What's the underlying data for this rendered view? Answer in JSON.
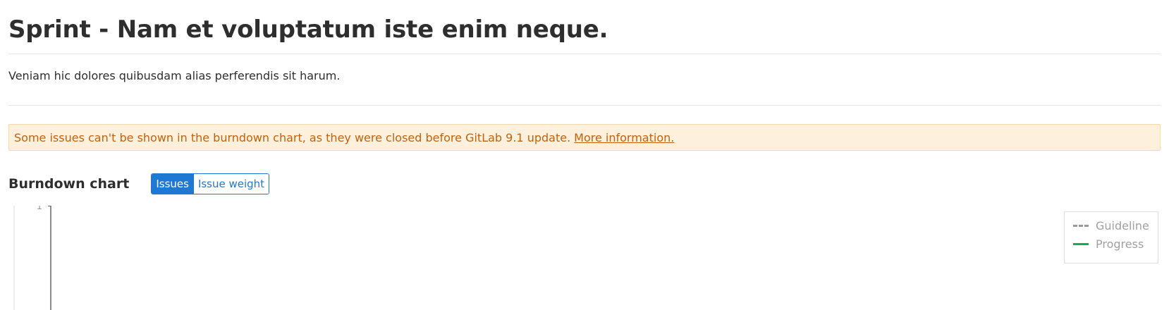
{
  "page": {
    "title": "Sprint - Nam et voluptatum iste enim neque.",
    "description": "Veniam hic dolores quibusdam alias perferendis sit harum."
  },
  "alert": {
    "message": "Some issues can't be shown in the burndown chart, as they were closed before GitLab 9.1 update.",
    "link_text": "More information."
  },
  "burndown": {
    "section_title": "Burndown chart",
    "toggle": {
      "issues_label": "Issues",
      "issue_weight_label": "Issue weight",
      "active": "Issues"
    }
  },
  "chart_data": {
    "type": "line",
    "y_ticks": [
      "1"
    ],
    "legend": [
      {
        "name": "Guideline",
        "style": "dashed",
        "color": "#9a9a9a"
      },
      {
        "name": "Progress",
        "style": "solid",
        "color": "#1aaa55"
      }
    ],
    "legend_placement": "top-right",
    "series": []
  },
  "colors": {
    "accent": "#1f78d1",
    "warning_text": "#c4610d",
    "warning_bg": "#fdf1dd",
    "progress": "#1aaa55",
    "guideline": "#9a9a9a"
  }
}
